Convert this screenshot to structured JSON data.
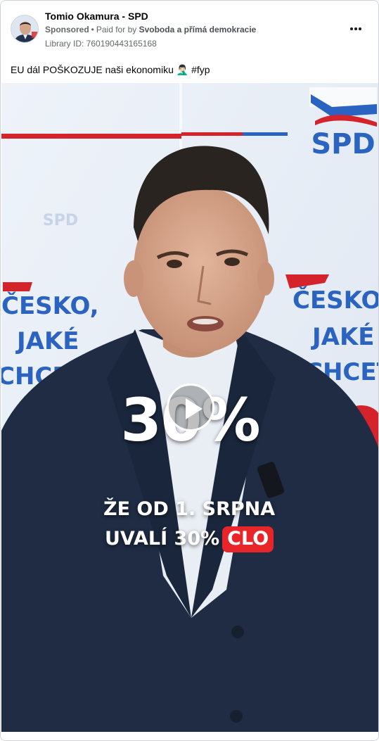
{
  "post": {
    "page_name": "Tomio Okamura - SPD",
    "sponsored_label": "Sponsored",
    "paid_for_prefix": "Paid for by",
    "payer": "Svoboda a přímá demokracie",
    "library_id": "Library ID: 760190443165168",
    "caption": "EU dál POŠKOZUJE naši ekonomiku 🤦🏻‍♂️ #fyp"
  },
  "video": {
    "backdrop_logo_text": "SPD",
    "faded_logo_text": "SPD",
    "backdrop_slogan_left": [
      "ČESKO,",
      "JAKÉ",
      "CHCE"
    ],
    "backdrop_slogan_right": [
      "ČESKO",
      "JAKÉ",
      "CHCET"
    ],
    "overlay_big": "30%",
    "overlay_line1": "ŽE OD 1. SRPNA",
    "overlay_line2_prefix": "UVALÍ 30%",
    "overlay_line2_badge": "CLO",
    "colors": {
      "spd_blue": "#1e5fb8",
      "spd_red": "#e8262a",
      "suit": "#1f2c44",
      "shirt": "#e9eef5"
    }
  },
  "icons": {
    "more": "more-horizontal-icon",
    "play": "play-icon"
  }
}
